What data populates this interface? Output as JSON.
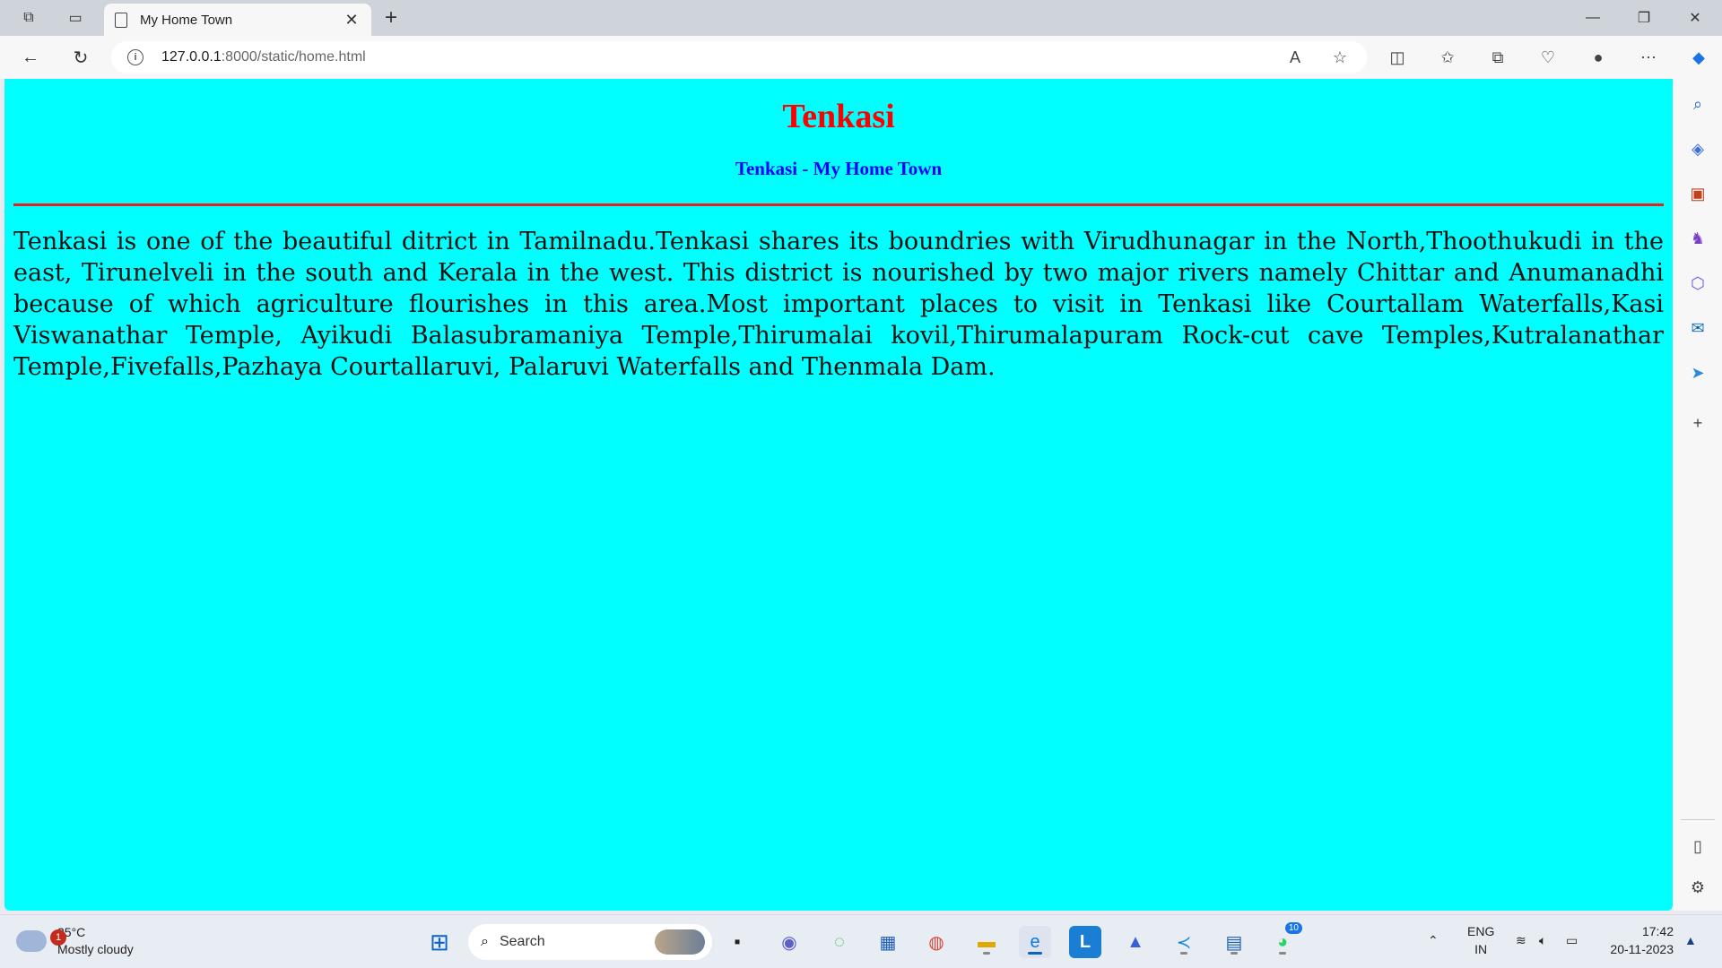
{
  "browser": {
    "tab_title": "My Home Town",
    "url_host": "127.0.0.1",
    "url_path": ":8000/static/home.html"
  },
  "page": {
    "heading": "Tenkasi",
    "subheading": "Tenkasi - My Home Town",
    "paragraph": "Tenkasi is one of the beautiful ditrict in Tamilnadu.Tenkasi shares its boundries with Virudhunagar in the North,Thoothukudi in the east, Tirunelveli in the south and Kerala in the west. This district is nourished by two major rivers namely Chittar and Anumanadhi because of which agriculture flourishes in this area.Most important places to visit in Tenkasi like Courtallam Waterfalls,Kasi Viswanathar Temple, Ayikudi Balasubramaniya Temple,Thirumalai kovil,Thirumalapuram Rock-cut cave Temples,Kutralanathar Temple,Fivefalls,Pazhaya Courtallaruvi, Palaruvi Waterfalls and Thenmala Dam.",
    "colors": {
      "background": "#00ffff",
      "heading": "#ff0000",
      "subheading": "#0000ff",
      "rule": "#e52222"
    }
  },
  "taskbar": {
    "weather_temp": "25°C",
    "weather_desc": "Mostly cloudy",
    "weather_badge": "1",
    "search_label": "Search",
    "whatsapp_badge": "10",
    "lang_top": "ENG",
    "lang_bottom": "IN",
    "time": "17:42",
    "date": "20-11-2023"
  }
}
